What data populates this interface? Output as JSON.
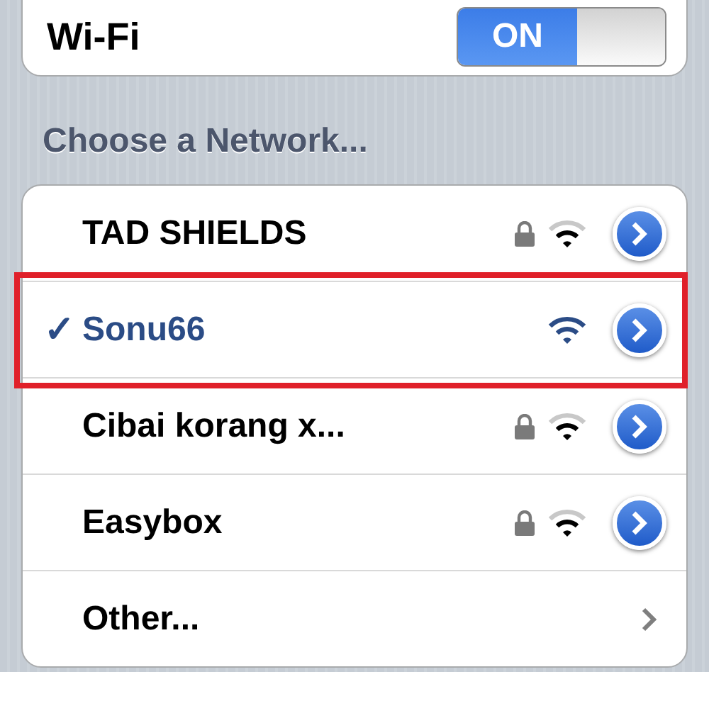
{
  "wifi": {
    "label": "Wi-Fi",
    "on": true,
    "on_text": "ON"
  },
  "section_header": "Choose a Network...",
  "networks": [
    {
      "kind": "network",
      "name": "TAD SHIELDS",
      "selected": false,
      "locked": true,
      "highlighted": false
    },
    {
      "kind": "network",
      "name": "Sonu66",
      "selected": true,
      "locked": false,
      "highlighted": true,
      "check": "✓"
    },
    {
      "kind": "network",
      "name": "Cibai korang x...",
      "selected": false,
      "locked": true,
      "highlighted": false
    },
    {
      "kind": "network",
      "name": "Easybox",
      "selected": false,
      "locked": true,
      "highlighted": false
    },
    {
      "kind": "other",
      "name": "Other..."
    }
  ]
}
